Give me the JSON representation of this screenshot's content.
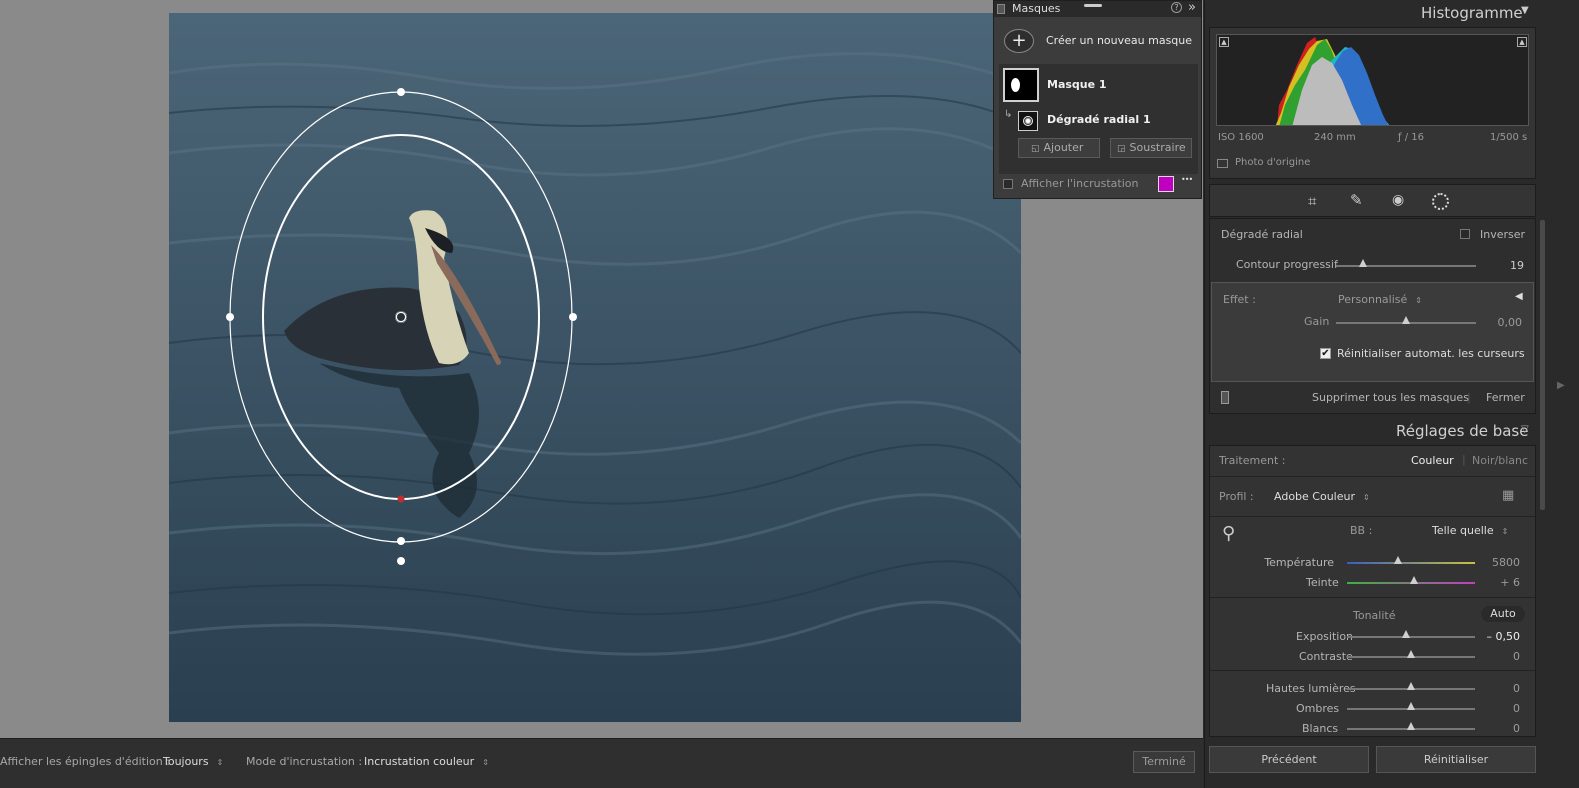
{
  "masks_panel": {
    "title": "Masques",
    "create_label": "Créer un nouveau masque",
    "mask1_label": "Masque 1",
    "radial_label": "Dégradé radial 1",
    "add_label": "Ajouter",
    "subtract_label": "Soustraire",
    "overlay_label": "Afficher l'incrustation",
    "overlay_color": "#c000c0",
    "help_icon": "?",
    "more_icon": "•••"
  },
  "bottom_bar": {
    "pins_label": "Afficher les épingles d'édition :",
    "pins_value": "Toujours",
    "overlay_mode_label": "Mode d'incrustation :",
    "overlay_mode_value": "Incrustation couleur",
    "done_label": "Terminé"
  },
  "histogram": {
    "title": "Histogramme",
    "iso": "ISO 1600",
    "focal": "240 mm",
    "aperture": "ƒ / 16",
    "shutter": "1/500 s",
    "original_label": "Photo d'origine"
  },
  "radial": {
    "title": "Dégradé radial",
    "invert_label": "Inverser",
    "feather_label": "Contour progressif",
    "feather_value": "19",
    "feather_pos": 0.19,
    "effect_label": "Effet :",
    "effect_value": "Personnalisé",
    "gain_label": "Gain",
    "gain_value": "0,00",
    "gain_pos": 0.5,
    "auto_reset_label": "Réinitialiser automat. les curseurs",
    "delete_all_label": "Supprimer tous les masques",
    "close_label": "Fermer"
  },
  "basic": {
    "title": "Réglages de base",
    "treatment_label": "Traitement :",
    "color_label": "Couleur",
    "bw_label": "Noir/blanc",
    "profile_label": "Profil :",
    "profile_value": "Adobe Couleur",
    "wb_label": "BB :",
    "wb_value": "Telle quelle",
    "temp_label": "Température",
    "temp_value": "5800",
    "temp_pos": 0.4,
    "tint_label": "Teinte",
    "tint_value": "+ 6",
    "tint_pos": 0.52,
    "tone_label": "Tonalité",
    "auto_label": "Auto",
    "exposure_label": "Exposition",
    "exposure_value": "– 0,50",
    "exposure_pos": 0.46,
    "contrast_label": "Contraste",
    "contrast_value": "0",
    "contrast_pos": 0.5,
    "highlights_label": "Hautes lumières",
    "highlights_value": "0",
    "highlights_pos": 0.5,
    "shadows_label": "Ombres",
    "shadows_value": "0",
    "shadows_pos": 0.5,
    "whites_label": "Blancs",
    "whites_value": "0",
    "whites_pos": 0.5
  },
  "footer": {
    "previous_label": "Précédent",
    "reset_label": "Réinitialiser"
  }
}
